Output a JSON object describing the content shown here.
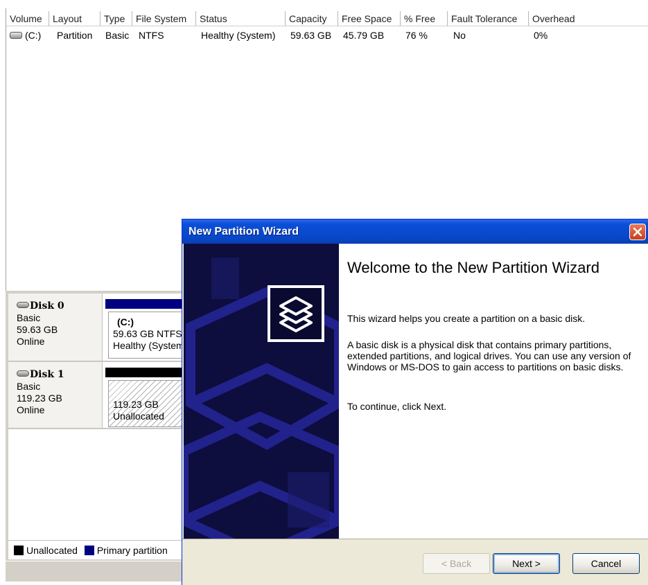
{
  "volume_list": {
    "columns": [
      "Volume",
      "Layout",
      "Type",
      "File System",
      "Status",
      "Capacity",
      "Free Space",
      "% Free",
      "Fault Tolerance",
      "Overhead"
    ],
    "rows": [
      {
        "volume": "(C:)",
        "layout": "Partition",
        "type": "Basic",
        "file_system": "NTFS",
        "status": "Healthy (System)",
        "capacity": "59.63 GB",
        "free_space": "45.79 GB",
        "percent_free": "76 %",
        "fault_tolerance": "No",
        "overhead": "0%"
      }
    ]
  },
  "disks": [
    {
      "name": "Disk 0",
      "type": "Basic",
      "size": "59.63 GB",
      "state": "Online",
      "partition": {
        "label": "(C:)",
        "size_fs": "59.63 GB NTFS",
        "status": "Healthy (System"
      },
      "bar_color": "#000080"
    },
    {
      "name": "Disk 1",
      "type": "Basic",
      "size": "119.23 GB",
      "state": "Online",
      "partition": {
        "size": "119.23 GB",
        "status": "Unallocated"
      },
      "bar_color": "#000000"
    }
  ],
  "legend": {
    "unallocated": {
      "label": "Unallocated",
      "color": "#000000"
    },
    "primary": {
      "label": "Primary partition",
      "color": "#000080"
    }
  },
  "wizard": {
    "title": "New Partition Wizard",
    "heading": "Welcome to the New Partition Wizard",
    "paragraph1": "This wizard helps you create a partition on a basic disk.",
    "paragraph2": "A basic disk is a physical disk that contains primary partitions, extended partitions, and logical drives. You can use any version of Windows or MS-DOS to gain access to partitions on basic disks.",
    "paragraph3": "To continue, click Next.",
    "buttons": {
      "back": "< Back",
      "next": "Next >",
      "cancel": "Cancel"
    },
    "close_icon": "close-icon",
    "badge_icon": "stacked-disks-icon"
  },
  "colors": {
    "title_bar": "#0a4fd8",
    "side_panel": "#0d0d3e",
    "primary_partition": "#000080"
  }
}
